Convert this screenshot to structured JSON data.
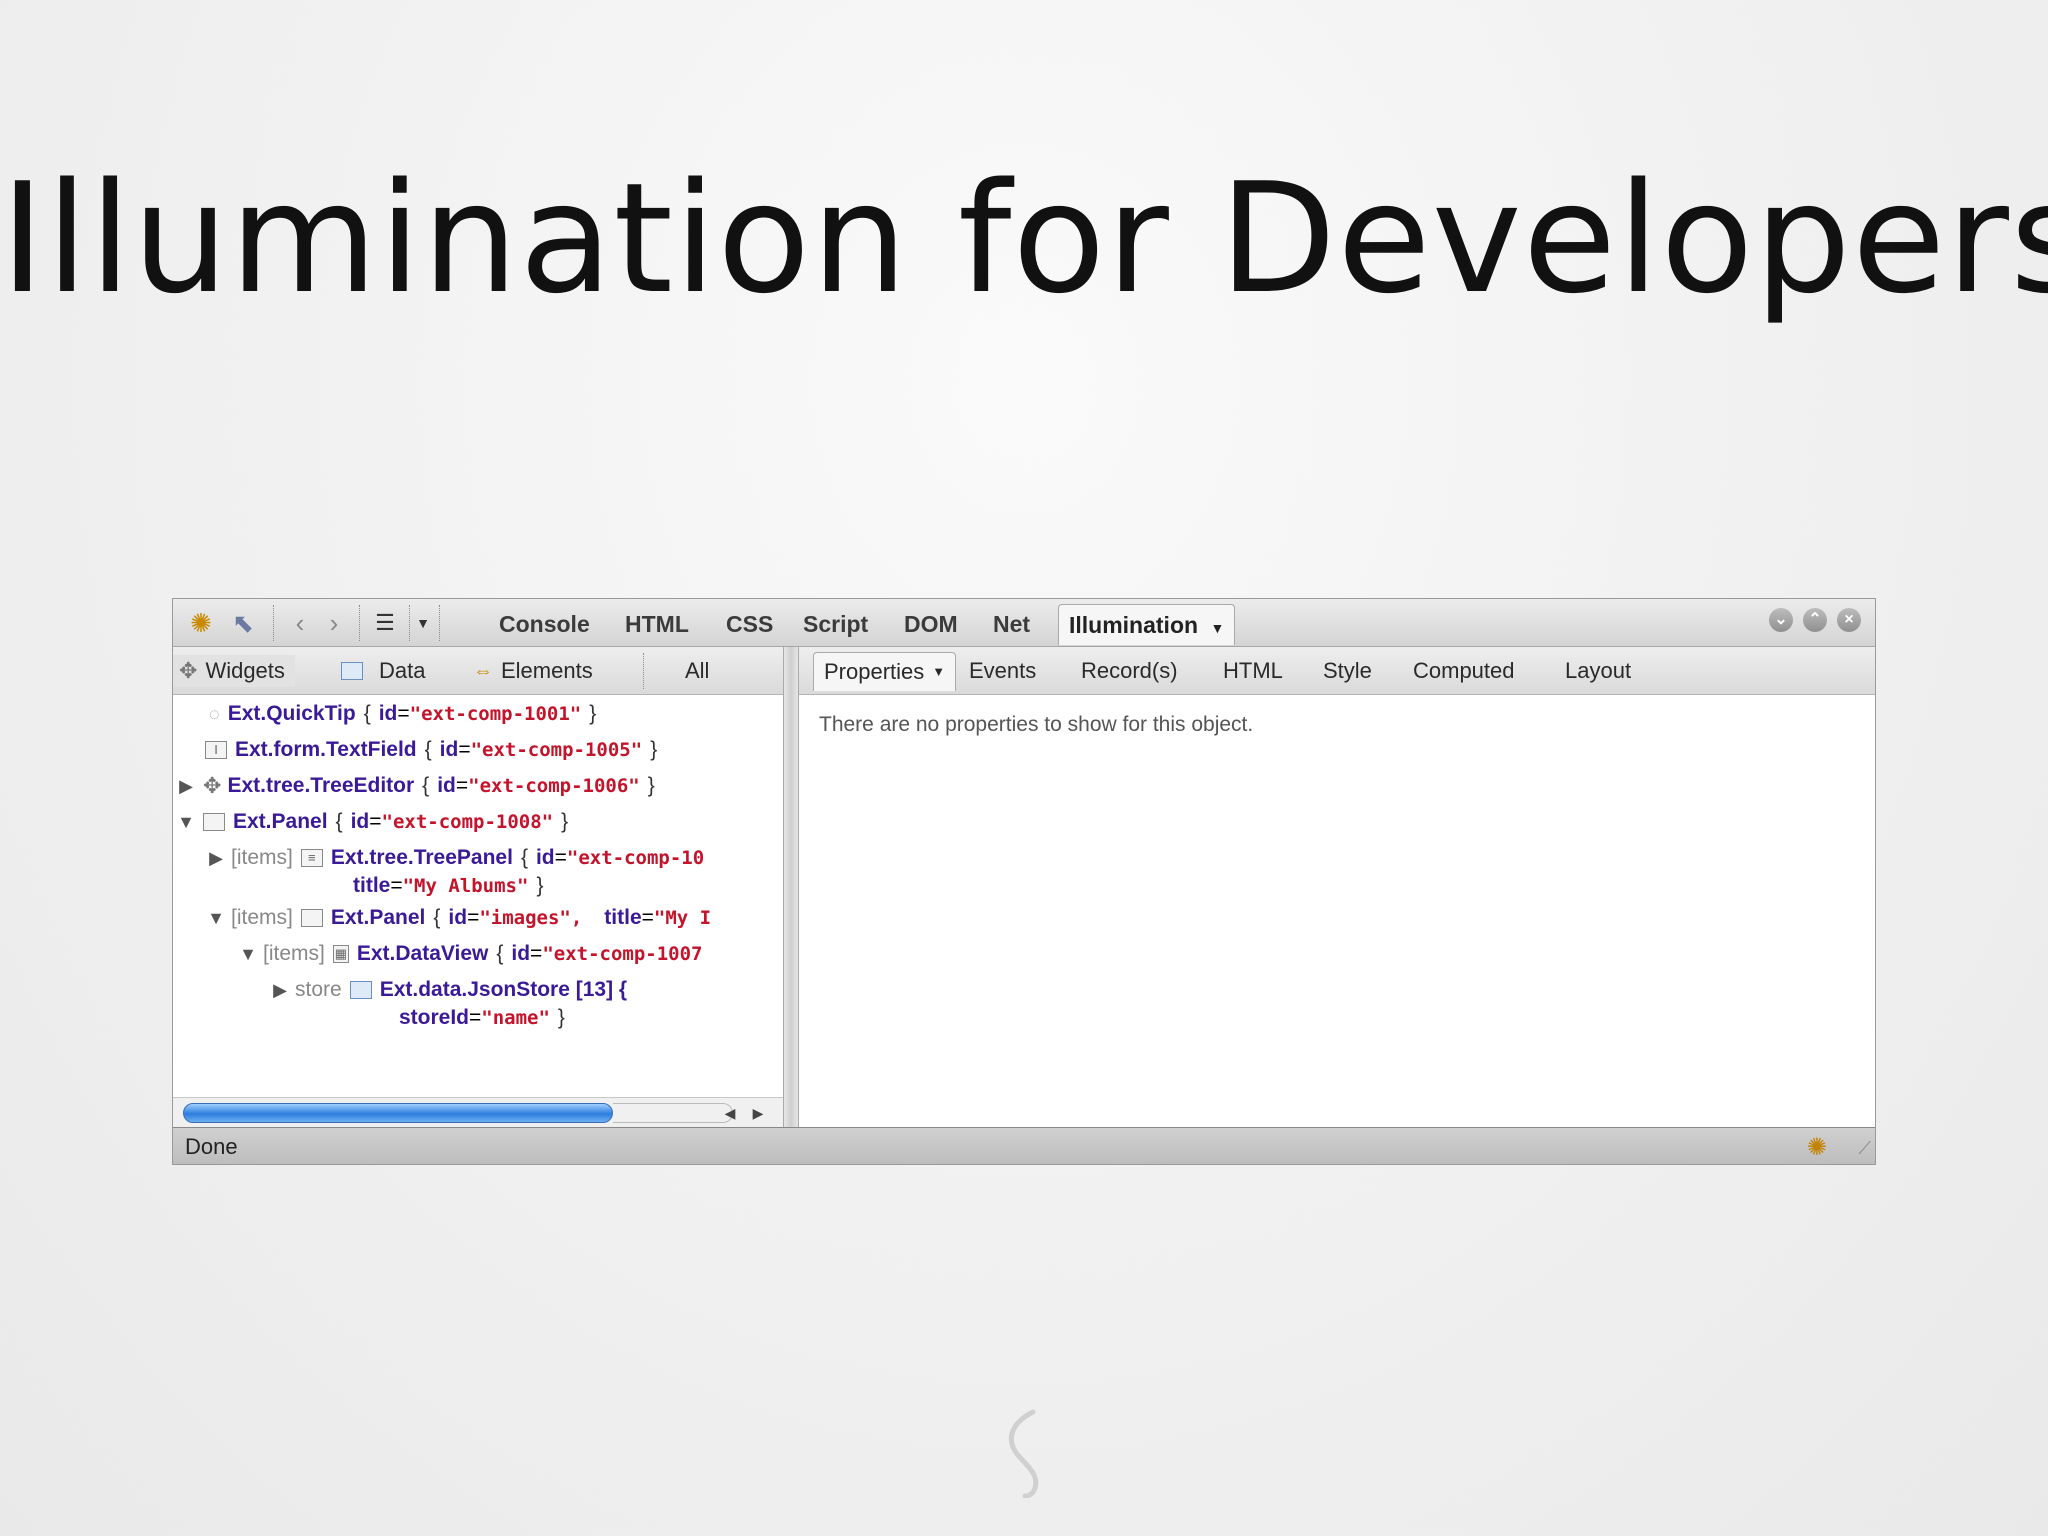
{
  "slide": {
    "title": "Illumination for Developers"
  },
  "toolbar": {
    "tabs": [
      "Console",
      "HTML",
      "CSS",
      "Script",
      "DOM",
      "Net",
      "Illumination"
    ],
    "active_tab": "Illumination",
    "icons": [
      "firebug-bug-icon",
      "inspect-pointer-icon",
      "back-arrow-icon",
      "forward-arrow-icon",
      "list-menu-icon",
      "dropdown-caret-icon"
    ],
    "window_buttons": [
      "minimize-icon",
      "detach-icon",
      "close-icon"
    ]
  },
  "left_panel": {
    "tabs": [
      {
        "label": "Widgets",
        "icon": "puzzle-icon"
      },
      {
        "label": "Data",
        "icon": "table-icon"
      },
      {
        "label": "Elements",
        "icon": "element-icon"
      },
      {
        "label": "All",
        "icon": ""
      }
    ],
    "tree": [
      {
        "arrow": "",
        "prefix": "",
        "cls": "Ext.QuickTip",
        "key": "id",
        "value": "\"ext-comp-1001\"",
        "close": "}"
      },
      {
        "arrow": "",
        "prefix": "",
        "cls": "Ext.form.TextField",
        "key": "id",
        "value": "\"ext-comp-1005\"",
        "close": "}"
      },
      {
        "arrow": "▶",
        "prefix": "",
        "cls": "Ext.tree.TreeEditor",
        "key": "id",
        "value": "\"ext-comp-1006\"",
        "close": "}"
      },
      {
        "arrow": "▼",
        "prefix": "",
        "cls": "Ext.Panel",
        "key": "id",
        "value": "\"ext-comp-1008\"",
        "close": "}"
      },
      {
        "arrow": "▶",
        "prefix": "[items]",
        "cls": "Ext.tree.TreePanel",
        "key": "id",
        "value": "\"ext-comp-10",
        "line2_key": "title",
        "line2_value": "\"My Albums\"",
        "close": "}"
      },
      {
        "arrow": "▼",
        "prefix": "[items]",
        "cls": "Ext.Panel",
        "key": "id",
        "value": "\"images\",",
        "key2": "title",
        "value2": "\"My I"
      },
      {
        "arrow": "▼",
        "prefix": "[items]",
        "cls": "Ext.DataView",
        "key": "id",
        "value": "\"ext-comp-1007"
      },
      {
        "arrow": "▶",
        "prefix": "store",
        "cls": "Ext.data.JsonStore [13] {",
        "line2_key": "storeId",
        "line2_value": "\"name\"",
        "close": "}"
      }
    ]
  },
  "right_panel": {
    "tabs": [
      "Properties",
      "Events",
      "Record(s)",
      "HTML",
      "Style",
      "Computed",
      "Layout"
    ],
    "active_tab": "Properties",
    "message": "There are no properties to show for this object."
  },
  "status": {
    "text": "Done"
  }
}
